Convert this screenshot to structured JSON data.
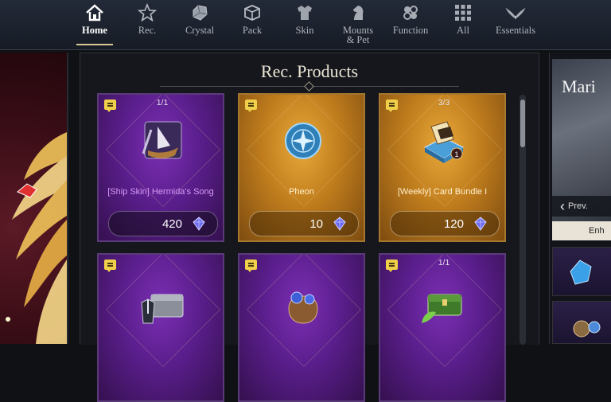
{
  "nav": {
    "items": [
      {
        "label": "Home",
        "icon": "home-icon",
        "active": true
      },
      {
        "label": "Rec.",
        "icon": "star-icon"
      },
      {
        "label": "Crystal",
        "icon": "crystal-icon"
      },
      {
        "label": "Pack",
        "icon": "pack-icon"
      },
      {
        "label": "Skin",
        "icon": "skin-icon"
      },
      {
        "label": "Mounts\n& Pet",
        "icon": "horse-icon"
      },
      {
        "label": "Function",
        "icon": "function-icon"
      },
      {
        "label": "All",
        "icon": "grid-icon"
      },
      {
        "label": "Essentials",
        "icon": "wings-icon"
      }
    ]
  },
  "panel": {
    "title": "Rec. Products"
  },
  "cards": [
    {
      "name": "[Ship Skin] Hermida's Song",
      "price": "420",
      "limit": "1/1",
      "theme": "purple"
    },
    {
      "name": "Pheon",
      "price": "10",
      "limit": "",
      "theme": "gold"
    },
    {
      "name": "[Weekly] Card Bundle I",
      "price": "120",
      "limit": "3/3",
      "theme": "gold"
    },
    {
      "name": "",
      "price": "",
      "limit": "",
      "theme": "purple"
    },
    {
      "name": "",
      "price": "",
      "limit": "",
      "theme": "purple"
    },
    {
      "name": "",
      "price": "",
      "limit": "1/1",
      "theme": "purple"
    }
  ],
  "right": {
    "banner_title": "Mari",
    "prev_label": "Prev.",
    "enh_label": "Enh"
  },
  "colors": {
    "accent_gold": "#d8c79a",
    "purple": "#5a1e8c",
    "gold": "#c07d1d"
  }
}
